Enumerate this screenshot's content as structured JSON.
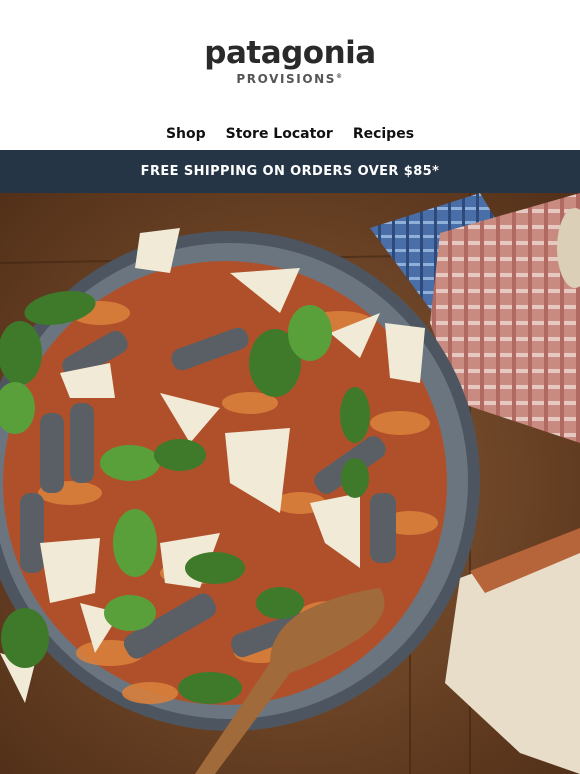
{
  "brand": {
    "name": "patagonia",
    "sub": "PROVISIONS"
  },
  "nav": {
    "items": [
      {
        "label": "Shop"
      },
      {
        "label": "Store Locator"
      },
      {
        "label": "Recipes"
      }
    ]
  },
  "banner": {
    "text": "FREE SHIPPING ON ORDERS OVER $85*"
  },
  "hero": {
    "image": "pasta-with-sardines-basil-parmesan-photo"
  },
  "colors": {
    "banner_bg": "#253546",
    "wood": "#7a4a2a",
    "pan": "#5d6670"
  }
}
